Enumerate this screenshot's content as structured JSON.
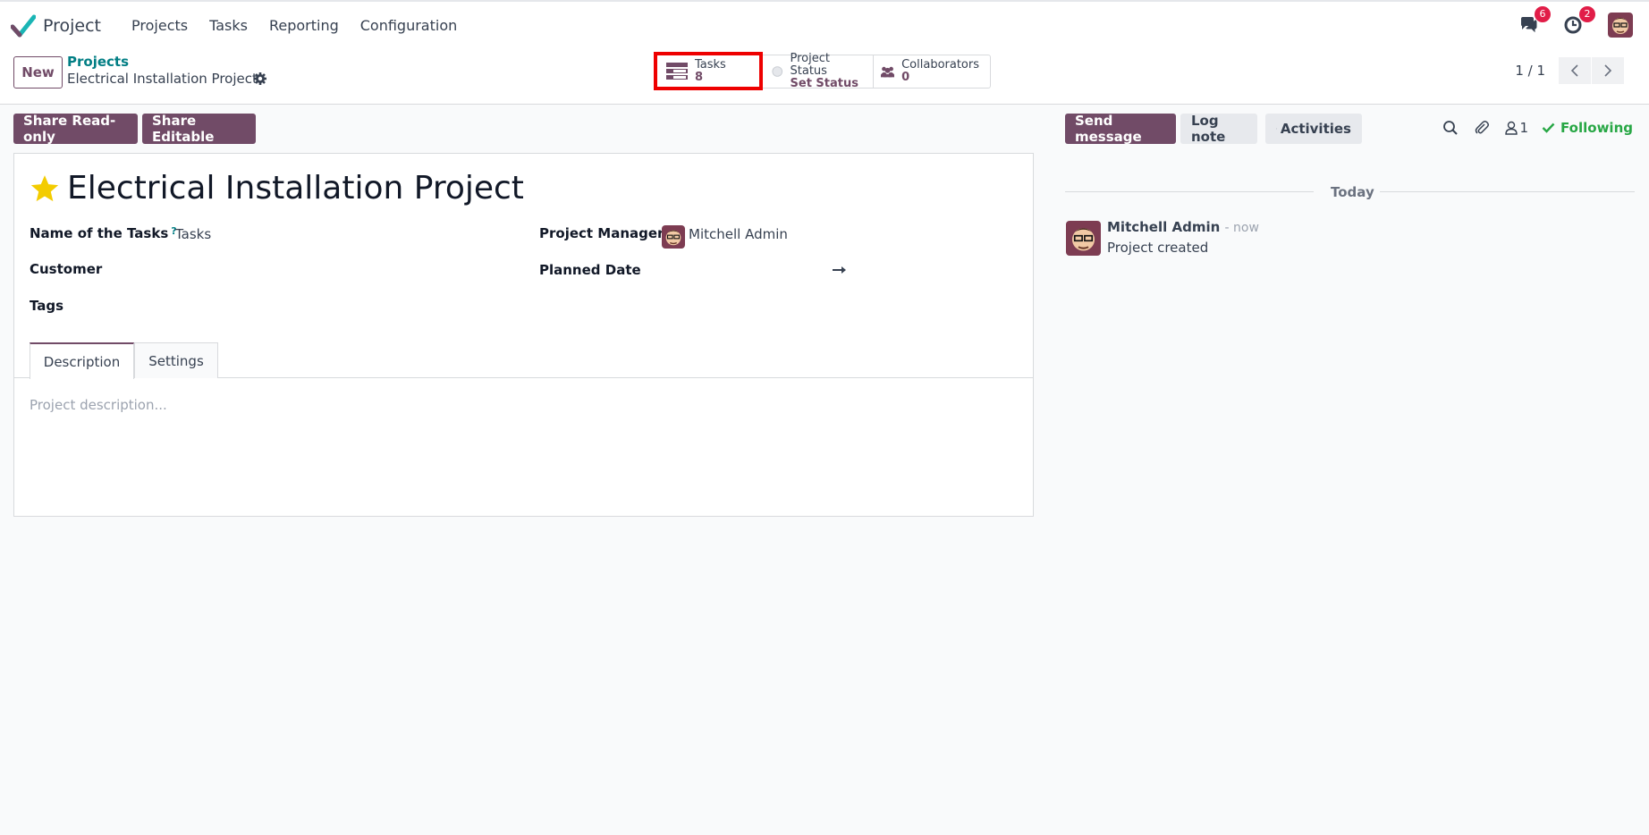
{
  "navbar": {
    "app_name": "Project",
    "menu": [
      "Projects",
      "Tasks",
      "Reporting",
      "Configuration"
    ],
    "messages_count": "6",
    "activities_count": "2",
    "icons": [
      "project-logo-icon",
      "chat-icon",
      "clock-icon",
      "user-avatar"
    ]
  },
  "control_panel": {
    "new_label": "New",
    "breadcrumb_parent": "Projects",
    "breadcrumb_current": "Electrical Installation Project",
    "smart_buttons": {
      "tasks_label": "Tasks",
      "tasks_value": "8",
      "status_label": "Project Status",
      "status_value": "Set Status",
      "collaborators_label": "Collaborators",
      "collaborators_value": "0"
    },
    "pager": "1 / 1"
  },
  "actions": {
    "share_readonly": "Share Read-only",
    "share_editable": "Share Editable"
  },
  "form": {
    "title": "Electrical Installation Project",
    "fields": {
      "tasks_name_label": "Name of the Tasks",
      "tasks_name_help": "?",
      "tasks_name_value": "Tasks",
      "customer_label": "Customer",
      "tags_label": "Tags",
      "manager_label": "Project Manager",
      "manager_value": "Mitchell Admin",
      "planned_date_label": "Planned Date"
    },
    "tabs": [
      "Description",
      "Settings"
    ],
    "description_placeholder": "Project description..."
  },
  "chatter": {
    "send_message": "Send message",
    "log_note": "Log note",
    "activities": "Activities",
    "followers_count": "1",
    "following_label": "Following",
    "date_separator": "Today",
    "message": {
      "author": "Mitchell Admin",
      "time": "- now",
      "body": "Project created"
    }
  },
  "colors": {
    "primary": "#714b67",
    "link": "#017e84",
    "highlight": "#ee0000",
    "following": "#28a745"
  }
}
